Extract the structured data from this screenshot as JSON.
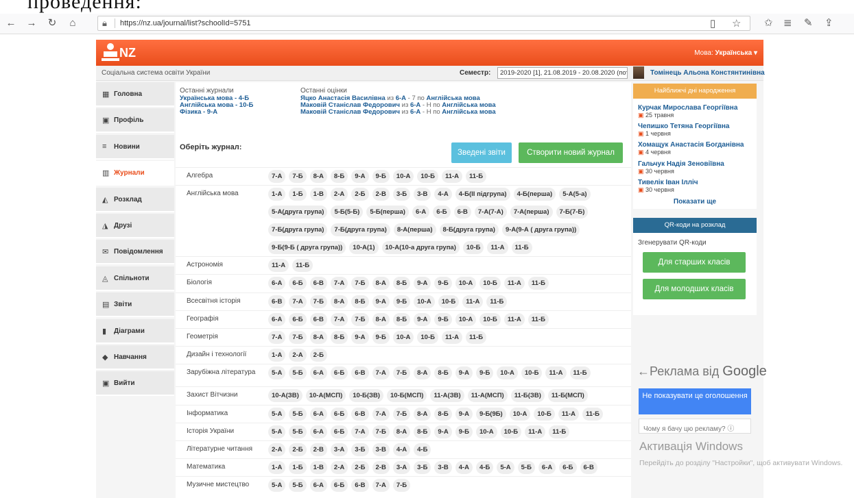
{
  "top_crop_text": "проведення:",
  "browser": {
    "url": "https://nz.ua/journal/list?schoolId=5751",
    "icons": [
      "back-arrow-icon",
      "forward-arrow-icon",
      "reload-icon",
      "home-icon",
      "lock-icon",
      "reader-icon",
      "star-icon",
      "favorites-icon",
      "collections-icon",
      "pen-icon",
      "share-icon"
    ]
  },
  "header": {
    "logo": "NZ",
    "lang_label": "Мова:",
    "lang_value": "Українська ▾"
  },
  "subbar": {
    "system": "Соціальна система освіти України",
    "semester_label": "Семестр:",
    "semester_value": "2019-2020 [1], 21.08.2019 - 20.08.2020 (поточний)",
    "user": "Томінець Альона Констянтинівна"
  },
  "sidebar": [
    {
      "label": "Головна",
      "icon": "▦"
    },
    {
      "label": "Профіль",
      "icon": "▣"
    },
    {
      "label": "Новини",
      "icon": "≡"
    },
    {
      "label": "Журнали",
      "icon": "▥"
    },
    {
      "label": "Розклад",
      "icon": "◭"
    },
    {
      "label": "Друзі",
      "icon": "◮"
    },
    {
      "label": "Повідомлення",
      "icon": "✉"
    },
    {
      "label": "Спільноти",
      "icon": "◬"
    },
    {
      "label": "Звіти",
      "icon": "▤"
    },
    {
      "label": "Діаграми",
      "icon": "▮"
    },
    {
      "label": "Навчання",
      "icon": "◆"
    },
    {
      "label": "Вийти",
      "icon": "▣"
    }
  ],
  "recent_journals": {
    "title": "Останні журнали",
    "items": [
      "Українська мова - 4-Б",
      "Англійська мова - 10-Б",
      "Фізика - 9-А"
    ]
  },
  "recent_grades": {
    "title": "Останні оцінки",
    "items": [
      {
        "name": "Яцко Анастасія Василівна",
        "from": "из",
        "class": "6-А",
        "grade": "- 7 по",
        "subject": "Англійська мова"
      },
      {
        "name": "Маковій Станіслав Федорович",
        "from": "из",
        "class": "6-А",
        "grade": "- Н по",
        "subject": "Англійська мова"
      },
      {
        "name": "Маковій Станіслав Федорович",
        "from": "из",
        "class": "6-А",
        "grade": "- Н по",
        "subject": "Англійська мова"
      }
    ]
  },
  "choose_label": "Оберіть журнал:",
  "btn_reports": "Зведені звіти",
  "btn_new": "Створити новий журнал",
  "subjects": [
    {
      "name": "Алгебра",
      "classes": [
        "7-А",
        "7-Б",
        "8-А",
        "8-Б",
        "9-А",
        "9-Б",
        "10-А",
        "10-Б",
        "11-А",
        "11-Б"
      ]
    },
    {
      "name": "Англійська мова",
      "classes": [
        "1-А",
        "1-Б",
        "1-В",
        "2-А",
        "2-Б",
        "2-В",
        "3-Б",
        "3-В",
        "4-А",
        "4-Б(ІІ підгрупа)",
        "4-Б(перша)",
        "5-А(5-а)",
        "5-А(друга група)",
        "5-Б(5-Б)",
        "5-Б(перша)",
        "6-А",
        "6-Б",
        "6-В",
        "7-А(7-А)",
        "7-А(перша)",
        "7-Б(7-Б)",
        "7-Б(друга група)",
        "7-Б(друга група)",
        "8-А(перша)",
        "8-Б(друга група)",
        "9-А(9-А ( друга група))",
        "9-Б(9-Б ( друга група))",
        "10-А(1)",
        "10-А(10-а друга група)",
        "10-Б",
        "11-А",
        "11-Б"
      ]
    },
    {
      "name": "Астрономія",
      "classes": [
        "11-А",
        "11-Б"
      ]
    },
    {
      "name": "Біологія",
      "classes": [
        "6-А",
        "6-Б",
        "6-В",
        "7-А",
        "7-Б",
        "8-А",
        "8-Б",
        "9-А",
        "9-Б",
        "10-А",
        "10-Б",
        "11-А",
        "11-Б"
      ]
    },
    {
      "name": "Всесвітня історія",
      "classes": [
        "6-В",
        "7-А",
        "7-Б",
        "8-А",
        "8-Б",
        "9-А",
        "9-Б",
        "10-А",
        "10-Б",
        "11-А",
        "11-Б"
      ]
    },
    {
      "name": "Географія",
      "classes": [
        "6-А",
        "6-Б",
        "6-В",
        "7-А",
        "7-Б",
        "8-А",
        "8-Б",
        "9-А",
        "9-Б",
        "10-А",
        "10-Б",
        "11-А",
        "11-Б"
      ]
    },
    {
      "name": "Геометрія",
      "classes": [
        "7-А",
        "7-Б",
        "8-А",
        "8-Б",
        "9-А",
        "9-Б",
        "10-А",
        "10-Б",
        "11-А",
        "11-Б"
      ]
    },
    {
      "name": "Дизайн і технології",
      "classes": [
        "1-А",
        "2-А",
        "2-Б"
      ]
    },
    {
      "name": "Зарубіжна література",
      "classes": [
        "5-А",
        "5-Б",
        "6-А",
        "6-Б",
        "6-В",
        "7-А",
        "7-Б",
        "8-А",
        "8-Б",
        "9-А",
        "9-Б",
        "10-А",
        "10-Б",
        "11-А",
        "11-Б"
      ]
    },
    {
      "name": "Захист Вітчизни",
      "classes": [
        "10-А(ЗВ)",
        "10-А(МСП)",
        "10-Б(ЗВ)",
        "10-Б(МСП)",
        "11-А(ЗВ)",
        "11-А(МСП)",
        "11-Б(ЗВ)",
        "11-Б(МСП)"
      ]
    },
    {
      "name": "Інформатика",
      "classes": [
        "5-А",
        "5-Б",
        "6-А",
        "6-Б",
        "6-В",
        "7-А",
        "7-Б",
        "8-А",
        "8-Б",
        "9-А",
        "9-Б(9Б)",
        "10-А",
        "10-Б",
        "11-А",
        "11-Б"
      ]
    },
    {
      "name": "Історія України",
      "classes": [
        "5-А",
        "5-Б",
        "6-А",
        "6-Б",
        "7-А",
        "7-Б",
        "8-А",
        "8-Б",
        "9-А",
        "9-Б",
        "10-А",
        "10-Б",
        "11-А",
        "11-Б"
      ]
    },
    {
      "name": "Літературне читання",
      "classes": [
        "2-А",
        "2-Б",
        "2-В",
        "3-А",
        "3-Б",
        "3-В",
        "4-А",
        "4-Б"
      ]
    },
    {
      "name": "Математика",
      "classes": [
        "1-А",
        "1-Б",
        "1-В",
        "2-А",
        "2-Б",
        "2-В",
        "3-А",
        "3-Б",
        "3-В",
        "4-А",
        "4-Б",
        "5-А",
        "5-Б",
        "6-А",
        "6-Б",
        "6-В"
      ]
    },
    {
      "name": "Музичне мистецтво",
      "classes": [
        "5-А",
        "5-Б",
        "6-А",
        "6-Б",
        "6-В",
        "7-А",
        "7-Б"
      ]
    }
  ],
  "birthdays": {
    "title": "Найближчі дні народження",
    "items": [
      {
        "name": "Курчак Мирослава Георгіївна",
        "date": "25 травня"
      },
      {
        "name": "Чепишко Тетяна Георгіївна",
        "date": "1 червня"
      },
      {
        "name": "Хомащук Анастасія Богданівна",
        "date": "4 червня"
      },
      {
        "name": "Гальчук Надія Зеновіївна",
        "date": "30 червня"
      },
      {
        "name": "Тивелік Іван Ілліч",
        "date": "30 червня"
      }
    ],
    "show_more": "Показати ще"
  },
  "qr": {
    "title": "QR-коди на розклад",
    "text": "Згенерувати QR-коди",
    "btn_senior": "Для старших класів",
    "btn_junior": "Для молодших класів"
  },
  "ad": {
    "title_prefix": "Реклама від",
    "title_brand": "Google",
    "btn": "Не показувати це оголошення",
    "why": "Чому я бачу цю рекламу? ⓘ"
  },
  "windows": {
    "title": "Активація Windows",
    "sub": "Перейдіть до розділу \"Настройки\", щоб активувати Windows."
  },
  "colors": {
    "brand": "#e94d1b",
    "link": "#1d5d95",
    "green": "#5cb85c",
    "blue": "#5bc0de"
  }
}
